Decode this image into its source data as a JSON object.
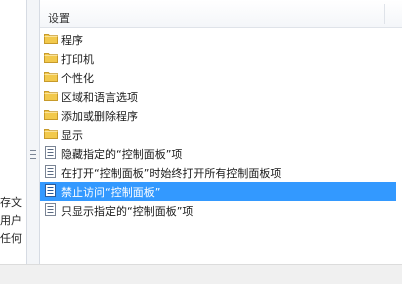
{
  "left_pane": {
    "lines": [
      "存文",
      "用户",
      "任何"
    ]
  },
  "header": {
    "column_label": "设置"
  },
  "items": [
    {
      "label": "程序",
      "icon": "folder-icon",
      "selected": false
    },
    {
      "label": "打印机",
      "icon": "folder-icon",
      "selected": false
    },
    {
      "label": "个性化",
      "icon": "folder-icon",
      "selected": false
    },
    {
      "label": "区域和语言选项",
      "icon": "folder-icon",
      "selected": false
    },
    {
      "label": "添加或删除程序",
      "icon": "folder-icon",
      "selected": false
    },
    {
      "label": "显示",
      "icon": "folder-icon",
      "selected": false
    },
    {
      "label": "隐藏指定的“控制面板”项",
      "icon": "policy-setting-icon",
      "selected": false
    },
    {
      "label": "在打开“控制面板”时始终打开所有控制面板项",
      "icon": "policy-setting-icon",
      "selected": false
    },
    {
      "label": "禁止访问“控制面板”",
      "icon": "policy-setting-icon",
      "selected": true
    },
    {
      "label": "只显示指定的“控制面板”项",
      "icon": "policy-setting-icon",
      "selected": false
    }
  ],
  "colors": {
    "selection": "#3399ff",
    "folder": "#f2c94c"
  }
}
